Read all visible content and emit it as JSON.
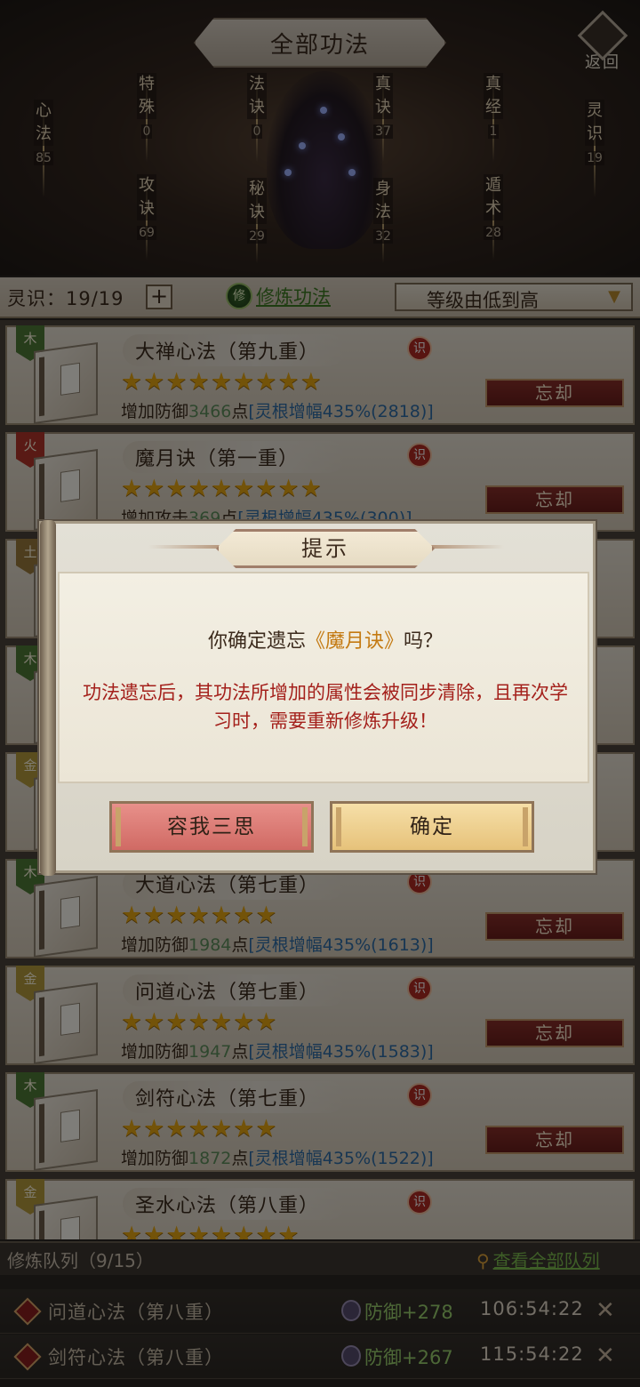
{
  "header": {
    "title": "全部功法",
    "back_label": "返回",
    "categories": [
      {
        "label": "心法",
        "count": "85"
      },
      {
        "label": "特殊",
        "count": "0"
      },
      {
        "label": "攻诀",
        "count": "69"
      },
      {
        "label": "法诀",
        "count": "0"
      },
      {
        "label": "秘诀",
        "count": "29"
      },
      {
        "label": "真诀",
        "count": "37"
      },
      {
        "label": "身法",
        "count": "32"
      },
      {
        "label": "真经",
        "count": "1"
      },
      {
        "label": "遁术",
        "count": "28"
      },
      {
        "label": "灵识",
        "count": "19"
      }
    ]
  },
  "toolbar": {
    "lingshi": "灵识：19/19",
    "plus": "+",
    "train_icon": "修",
    "train_label": "修炼功法",
    "sort_label": "等级由低到高"
  },
  "skills": [
    {
      "element": "木",
      "element_color": "#4f7a37",
      "name": "大禅心法（第九重）",
      "stars": 9,
      "effect_prefix": "增加防御",
      "effect_value": "3466",
      "effect_unit": "点",
      "bonus": "[灵根增幅435%(2818)]",
      "forget": "忘却"
    },
    {
      "element": "火",
      "element_color": "#b2342a",
      "name": "魔月诀（第一重）",
      "stars": 9,
      "effect_prefix": "增加攻击",
      "effect_value": "369",
      "effect_unit": "点",
      "bonus": "[灵根增幅435%(300)]",
      "forget": "忘却"
    },
    {
      "element": "土",
      "element_color": "#9a7a3c",
      "name": "",
      "stars": 0,
      "effect_prefix": "",
      "effect_value": "",
      "effect_unit": "",
      "bonus": "",
      "forget": ""
    },
    {
      "element": "木",
      "element_color": "#4f7a37",
      "name": "",
      "stars": 0,
      "effect_prefix": "",
      "effect_value": "",
      "effect_unit": "",
      "bonus": "",
      "forget": ""
    },
    {
      "element": "金",
      "element_color": "#b59a3c",
      "name": "",
      "stars": 0,
      "effect_prefix": "",
      "effect_value": "",
      "effect_unit": "",
      "bonus": "",
      "forget": ""
    },
    {
      "element": "木",
      "element_color": "#4f7a37",
      "name": "大道心法（第七重）",
      "stars": 7,
      "effect_prefix": "增加防御",
      "effect_value": "1984",
      "effect_unit": "点",
      "bonus": "[灵根增幅435%(1613)]",
      "forget": "忘却"
    },
    {
      "element": "金",
      "element_color": "#b59a3c",
      "name": "问道心法（第七重）",
      "stars": 7,
      "effect_prefix": "增加防御",
      "effect_value": "1947",
      "effect_unit": "点",
      "bonus": "[灵根增幅435%(1583)]",
      "forget": "忘却"
    },
    {
      "element": "木",
      "element_color": "#4f7a37",
      "name": "剑符心法（第七重）",
      "stars": 7,
      "effect_prefix": "增加防御",
      "effect_value": "1872",
      "effect_unit": "点",
      "bonus": "[灵根增幅435%(1522)]",
      "forget": "忘却"
    },
    {
      "element": "金",
      "element_color": "#b59a3c",
      "name": "圣水心法（第八重）",
      "stars": 8,
      "effect_prefix": "",
      "effect_value": "",
      "effect_unit": "",
      "bonus": "",
      "forget": ""
    }
  ],
  "shi_icon_label": "识",
  "dialog": {
    "title": "提示",
    "question_prefix": "你确定遗忘",
    "question_skill": "《魔月诀》",
    "question_suffix": "吗？",
    "warning": "功法遗忘后，其功法所增加的属性会被同步清除，且再次学习时，需要重新修炼升级！",
    "cancel_label": "容我三思",
    "ok_label": "确定"
  },
  "queue": {
    "title": "修炼队列（9/15）",
    "view_all": "查看全部队列",
    "items": [
      {
        "name": "问道心法（第八重）",
        "bonus": "防御+278",
        "time": "106:54:22"
      },
      {
        "name": "剑符心法（第八重）",
        "bonus": "防御+267",
        "time": "115:54:22"
      }
    ]
  }
}
